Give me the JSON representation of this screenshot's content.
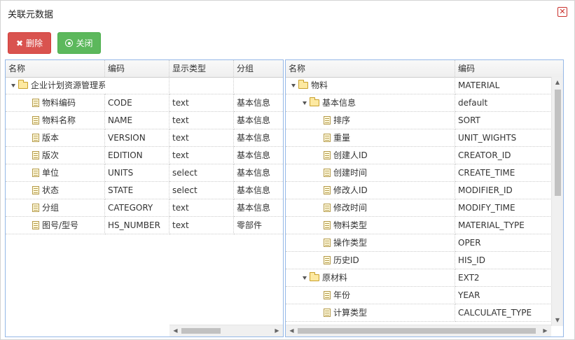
{
  "dialog": {
    "title": "关联元数据"
  },
  "toolbar": {
    "delete_label": "删除",
    "close_label": "关闭"
  },
  "left_grid": {
    "columns": [
      "名称",
      "编码",
      "显示类型",
      "分组"
    ],
    "root": {
      "name": "企业计划资源管理系"
    },
    "rows": [
      {
        "name": "物料编码",
        "code": "CODE",
        "type": "text",
        "group": "基本信息"
      },
      {
        "name": "物料名称",
        "code": "NAME",
        "type": "text",
        "group": "基本信息"
      },
      {
        "name": "版本",
        "code": "VERSION",
        "type": "text",
        "group": "基本信息"
      },
      {
        "name": "版次",
        "code": "EDITION",
        "type": "text",
        "group": "基本信息"
      },
      {
        "name": "单位",
        "code": "UNITS",
        "type": "select",
        "group": "基本信息"
      },
      {
        "name": "状态",
        "code": "STATE",
        "type": "select",
        "group": "基本信息"
      },
      {
        "name": "分组",
        "code": "CATEGORY",
        "type": "text",
        "group": "基本信息"
      },
      {
        "name": "图号/型号",
        "code": "HS_NUMBER",
        "type": "text",
        "group": "零部件"
      }
    ]
  },
  "right_grid": {
    "columns": [
      "名称",
      "编码"
    ],
    "rows": [
      {
        "name": "物料",
        "code": "MATERIAL",
        "kind": "folder",
        "level": 0
      },
      {
        "name": "基本信息",
        "code": "default",
        "kind": "folder",
        "level": 1
      },
      {
        "name": "排序",
        "code": "SORT",
        "kind": "file",
        "level": 2
      },
      {
        "name": "重量",
        "code": "UNIT_WIGHTS",
        "kind": "file",
        "level": 2
      },
      {
        "name": "创建人ID",
        "code": "CREATOR_ID",
        "kind": "file",
        "level": 2
      },
      {
        "name": "创建时间",
        "code": "CREATE_TIME",
        "kind": "file",
        "level": 2
      },
      {
        "name": "修改人ID",
        "code": "MODIFIER_ID",
        "kind": "file",
        "level": 2
      },
      {
        "name": "修改时间",
        "code": "MODIFY_TIME",
        "kind": "file",
        "level": 2
      },
      {
        "name": "物料类型",
        "code": "MATERIAL_TYPE",
        "kind": "file",
        "level": 2
      },
      {
        "name": "操作类型",
        "code": "OPER",
        "kind": "file",
        "level": 2
      },
      {
        "name": "历史ID",
        "code": "HIS_ID",
        "kind": "file",
        "level": 2
      },
      {
        "name": "原材料",
        "code": "EXT2",
        "kind": "folder",
        "level": 1
      },
      {
        "name": "年份",
        "code": "YEAR",
        "kind": "file",
        "level": 2
      },
      {
        "name": "计算类型",
        "code": "CALCULATE_TYPE",
        "kind": "file",
        "level": 2
      }
    ]
  },
  "icons": {
    "delete": "close-x-icon",
    "close": "circle-dot-icon",
    "folder": "folder-icon",
    "file": "document-icon",
    "expand": "expand-triangle-icon"
  }
}
